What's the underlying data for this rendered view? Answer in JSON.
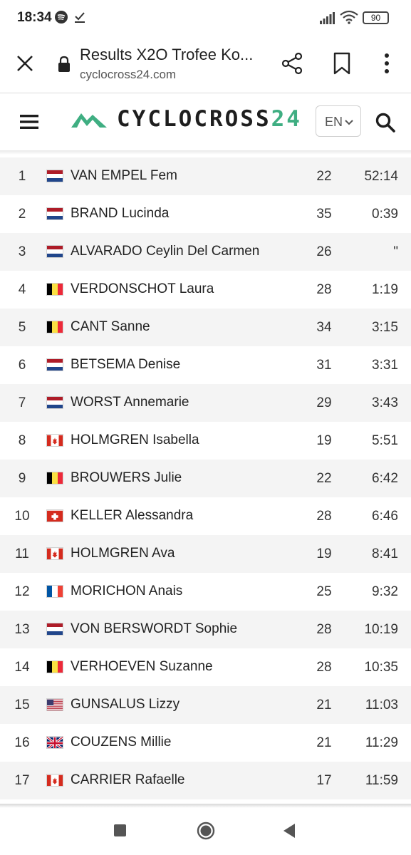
{
  "status_bar": {
    "time": "18:34",
    "battery": "90",
    "icons": [
      "spotify-icon",
      "check-download-icon",
      "signal-icon",
      "wifi-icon",
      "battery-icon"
    ]
  },
  "browser": {
    "title": "Results X2O Trofee Ko...",
    "url": "cyclocross24.com",
    "icons": [
      "close-icon",
      "lock-icon",
      "share-icon",
      "bookmark-icon",
      "more-icon"
    ]
  },
  "site_header": {
    "logo_text": "CYCLOCROSS",
    "logo_number": "24",
    "language": "EN",
    "brand_color": "#3fae82",
    "icons": [
      "menu-icon",
      "logo-mountain-icon",
      "chevron-down-icon",
      "search-icon"
    ]
  },
  "results": [
    {
      "pos": "1",
      "flag": "NL",
      "name": "VAN EMPEL Fem",
      "age": "22",
      "time": "52:14"
    },
    {
      "pos": "2",
      "flag": "NL",
      "name": "BRAND Lucinda",
      "age": "35",
      "time": "0:39"
    },
    {
      "pos": "3",
      "flag": "NL",
      "name": "ALVARADO Ceylin Del Carmen",
      "age": "26",
      "time": "\""
    },
    {
      "pos": "4",
      "flag": "BE",
      "name": "VERDONSCHOT Laura",
      "age": "28",
      "time": "1:19"
    },
    {
      "pos": "5",
      "flag": "BE",
      "name": "CANT Sanne",
      "age": "34",
      "time": "3:15"
    },
    {
      "pos": "6",
      "flag": "NL",
      "name": "BETSEMA Denise",
      "age": "31",
      "time": "3:31"
    },
    {
      "pos": "7",
      "flag": "NL",
      "name": "WORST Annemarie",
      "age": "29",
      "time": "3:43"
    },
    {
      "pos": "8",
      "flag": "CA",
      "name": "HOLMGREN Isabella",
      "age": "19",
      "time": "5:51"
    },
    {
      "pos": "9",
      "flag": "BE",
      "name": "BROUWERS Julie",
      "age": "22",
      "time": "6:42"
    },
    {
      "pos": "10",
      "flag": "CH",
      "name": "KELLER Alessandra",
      "age": "28",
      "time": "6:46"
    },
    {
      "pos": "11",
      "flag": "CA",
      "name": "HOLMGREN Ava",
      "age": "19",
      "time": "8:41"
    },
    {
      "pos": "12",
      "flag": "FR",
      "name": "MORICHON Anais",
      "age": "25",
      "time": "9:32"
    },
    {
      "pos": "13",
      "flag": "NL",
      "name": "VON BERSWORDT Sophie",
      "age": "28",
      "time": "10:19"
    },
    {
      "pos": "14",
      "flag": "BE",
      "name": "VERHOEVEN Suzanne",
      "age": "28",
      "time": "10:35"
    },
    {
      "pos": "15",
      "flag": "US",
      "name": "GUNSALUS Lizzy",
      "age": "21",
      "time": "11:03"
    },
    {
      "pos": "16",
      "flag": "GB",
      "name": "COUZENS Millie",
      "age": "21",
      "time": "11:29"
    },
    {
      "pos": "17",
      "flag": "CA",
      "name": "CARRIER Rafaelle",
      "age": "17",
      "time": "11:59"
    }
  ],
  "nav_bar": {
    "icons": [
      "recents-icon",
      "home-icon",
      "back-icon"
    ]
  }
}
